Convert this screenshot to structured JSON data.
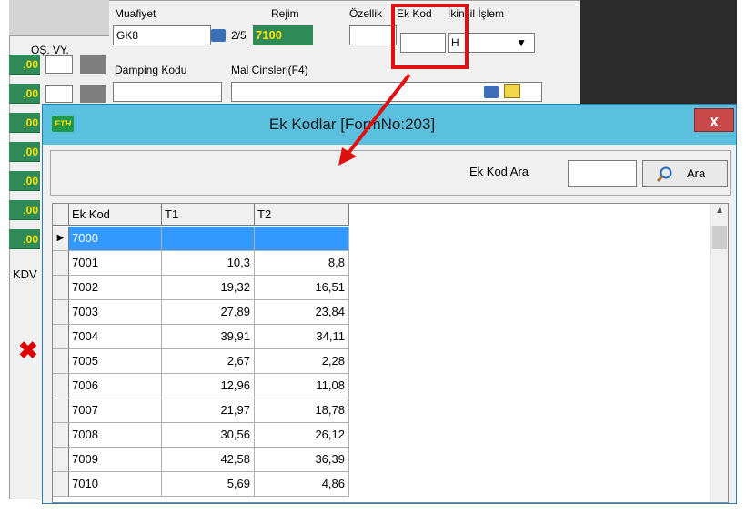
{
  "left_panel": {
    "header_label": "ÖŞ. VY.",
    "values": [
      ",00",
      ",00",
      ",00",
      ",00",
      ",00",
      ",00",
      ",00"
    ],
    "kdv_label": "KDV"
  },
  "top_form": {
    "muafiyet_label": "Muafiyet",
    "muafiyet_value": "GK8",
    "page_indicator": "2/5",
    "rejim_label": "Rejim",
    "rejim_value": "7100",
    "ozellik_label": "Özellik",
    "ek_kod_label": "Ek Kod",
    "ikincil_islem_label": "İkincil İşlem",
    "ikincil_islem_value": "H",
    "damping_kodu_label": "Damping Kodu",
    "mal_cinsleri_label": "Mal Cinsleri(F4)"
  },
  "dialog": {
    "title": "Ek Kodlar [FormNo:203]",
    "icon_text": "ETH",
    "close_label": "x",
    "search_label": "Ek Kod Ara",
    "search_value": "",
    "search_button": "Ara",
    "columns": [
      "Ek Kod",
      "T1",
      "T2"
    ],
    "rows": [
      {
        "kod": "7000",
        "t1": "",
        "t2": "",
        "selected": true
      },
      {
        "kod": "7001",
        "t1": "10,3",
        "t2": "8,8"
      },
      {
        "kod": "7002",
        "t1": "19,32",
        "t2": "16,51"
      },
      {
        "kod": "7003",
        "t1": "27,89",
        "t2": "23,84"
      },
      {
        "kod": "7004",
        "t1": "39,91",
        "t2": "34,11"
      },
      {
        "kod": "7005",
        "t1": "2,67",
        "t2": "2,28"
      },
      {
        "kod": "7006",
        "t1": "12,96",
        "t2": "11,08"
      },
      {
        "kod": "7007",
        "t1": "21,97",
        "t2": "18,78"
      },
      {
        "kod": "7008",
        "t1": "30,56",
        "t2": "26,12"
      },
      {
        "kod": "7009",
        "t1": "42,58",
        "t2": "36,39"
      },
      {
        "kod": "7010",
        "t1": "5,69",
        "t2": "4,86"
      }
    ]
  },
  "colors": {
    "title_bar": "#5bc0de",
    "selection": "#3399ff",
    "highlight": "#e01010",
    "rejim_bg": "#2e8b57",
    "rejim_text": "#ffe000"
  }
}
